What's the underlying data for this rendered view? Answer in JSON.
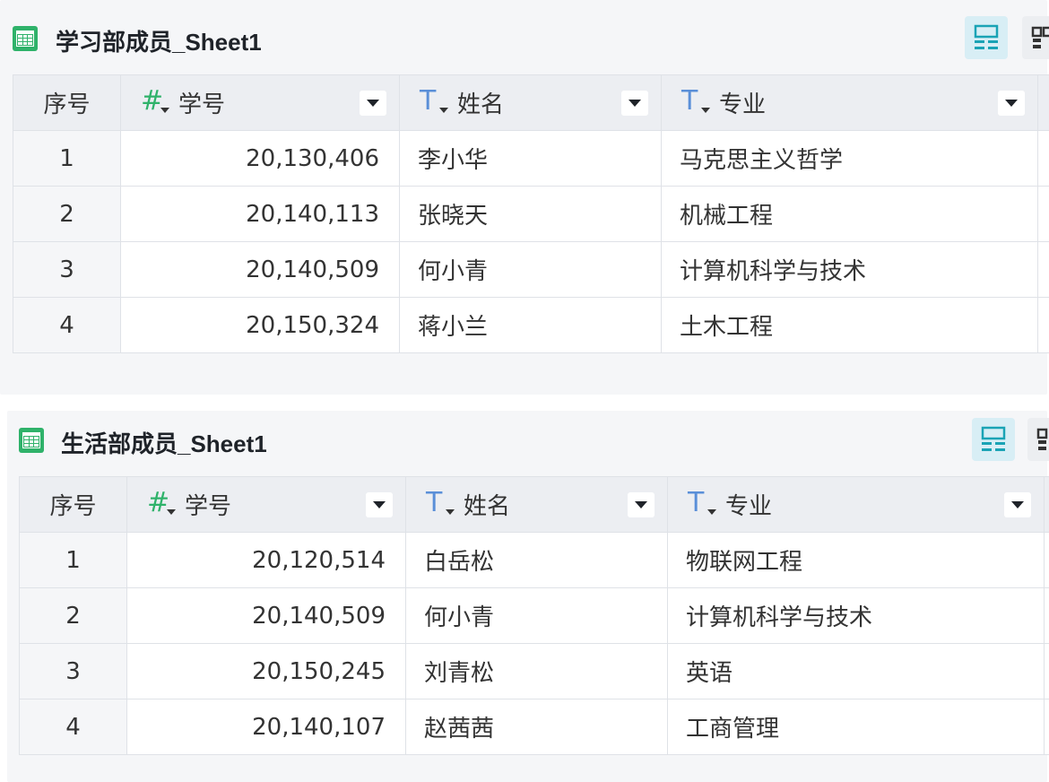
{
  "sheets": [
    {
      "title": "学习部成员_Sheet1",
      "columns": {
        "index": "序号",
        "id": "学号",
        "name": "姓名",
        "major": "专业"
      },
      "rows": [
        {
          "index": "1",
          "id": "20,130,406",
          "name": "李小华",
          "major": "马克思主义哲学"
        },
        {
          "index": "2",
          "id": "20,140,113",
          "name": "张晓天",
          "major": "机械工程"
        },
        {
          "index": "3",
          "id": "20,140,509",
          "name": "何小青",
          "major": "计算机科学与技术"
        },
        {
          "index": "4",
          "id": "20,150,324",
          "name": "蒋小兰",
          "major": "土木工程"
        }
      ]
    },
    {
      "title": "生活部成员_Sheet1",
      "columns": {
        "index": "序号",
        "id": "学号",
        "name": "姓名",
        "major": "专业"
      },
      "rows": [
        {
          "index": "1",
          "id": "20,120,514",
          "name": "白岳松",
          "major": "物联网工程"
        },
        {
          "index": "2",
          "id": "20,140,509",
          "name": "何小青",
          "major": "计算机科学与技术"
        },
        {
          "index": "3",
          "id": "20,150,245",
          "name": "刘青松",
          "major": "英语"
        },
        {
          "index": "4",
          "id": "20,140,107",
          "name": "赵茜茜",
          "major": "工商管理"
        }
      ]
    }
  ],
  "type_icons": {
    "number": "#",
    "text": "T"
  },
  "colors": {
    "accent": "#2fb26a",
    "text_type": "#5a8fd8",
    "active_view_bg": "#d8eef5"
  },
  "icons": [
    "sheet-table-icon",
    "card-view-icon",
    "grid-view-icon",
    "dropdown-caret-icon"
  ]
}
